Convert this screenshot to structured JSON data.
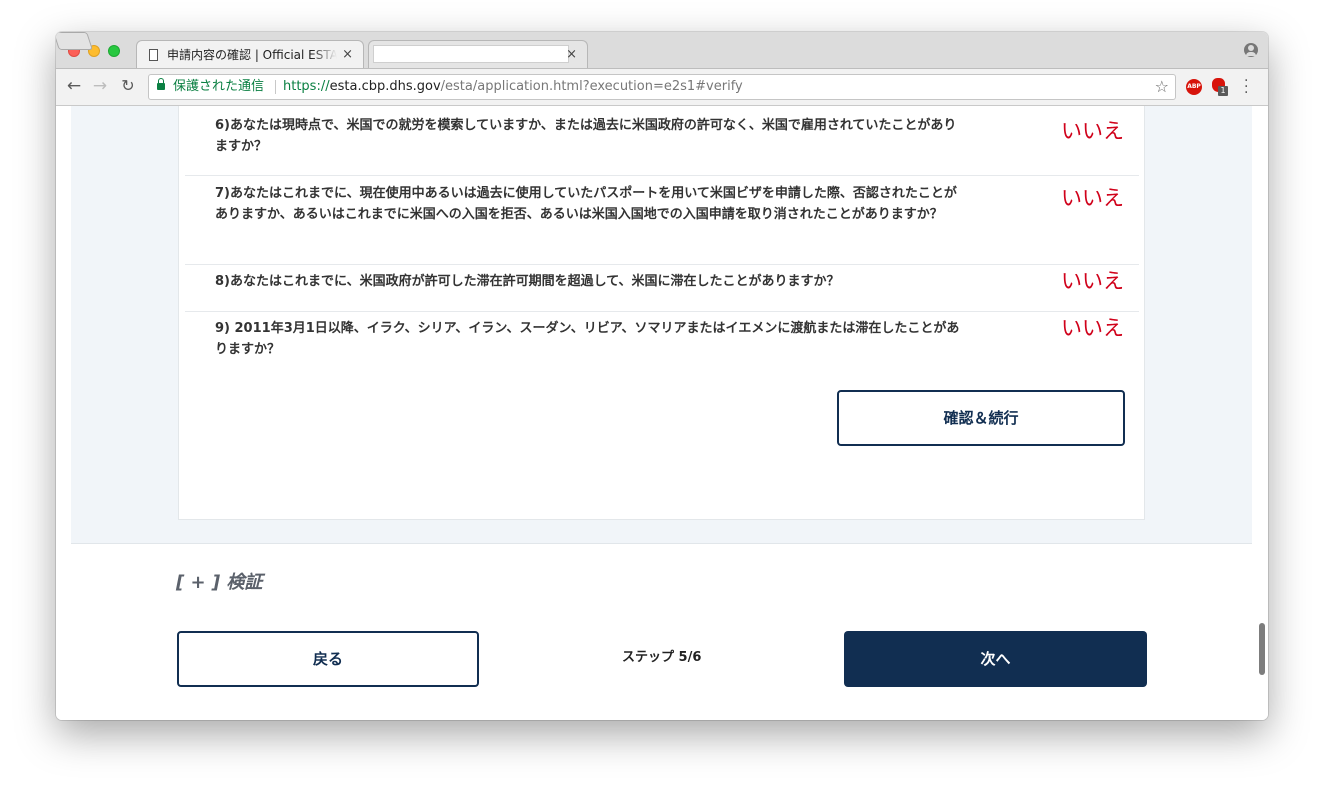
{
  "browser": {
    "tabs": [
      {
        "title": "申請内容の確認 | Official ESTA Application Website, U.S. Customs and Border Protection",
        "close": "×"
      },
      {
        "title": "",
        "close": "×"
      }
    ],
    "address": {
      "secure_label": "保護された通信",
      "url_scheme": "https://",
      "url_host": "esta.cbp.dhs.gov",
      "url_path": "/esta/application.html?execution=e2s1#verify"
    },
    "extensions": {
      "abp_label": "ABP",
      "ublock_badge": "1"
    }
  },
  "questions": [
    {
      "text": "6)あなたは現時点で、米国での就労を模索していますか、または過去に米国政府の許可なく、米国で雇用されていたことがありますか？",
      "answer": "いいえ"
    },
    {
      "text": "7)あなたはこれまでに、現在使用中あるいは過去に使用していたパスポートを用いて米国ビザを申請した際、否認されたことがありますか、あるいはこれまでに米国への入国を拒否、あるいは米国入国地での入国申請を取り消されたことがありますか？",
      "answer": "いいえ"
    },
    {
      "text": "8)あなたはこれまでに、米国政府が許可した滞在許可期間を超過して、米国に滞在したことがありますか？",
      "answer": "いいえ"
    },
    {
      "text": "9) 2011年3月1日以降、イラク、シリア、イラン、スーダン、リビア、ソマリアまたはイエメンに渡航または滞在したことがありますか？",
      "answer": "いいえ"
    }
  ],
  "confirm_button": "確認＆続行",
  "verify_section": "[ + ] 検証",
  "footer": {
    "back_label": "戻る",
    "step_label": "ステップ 5/6",
    "next_label": "次へ"
  },
  "colors": {
    "primary": "#112e51",
    "answer": "#d0021b",
    "secure": "#0b8043"
  }
}
